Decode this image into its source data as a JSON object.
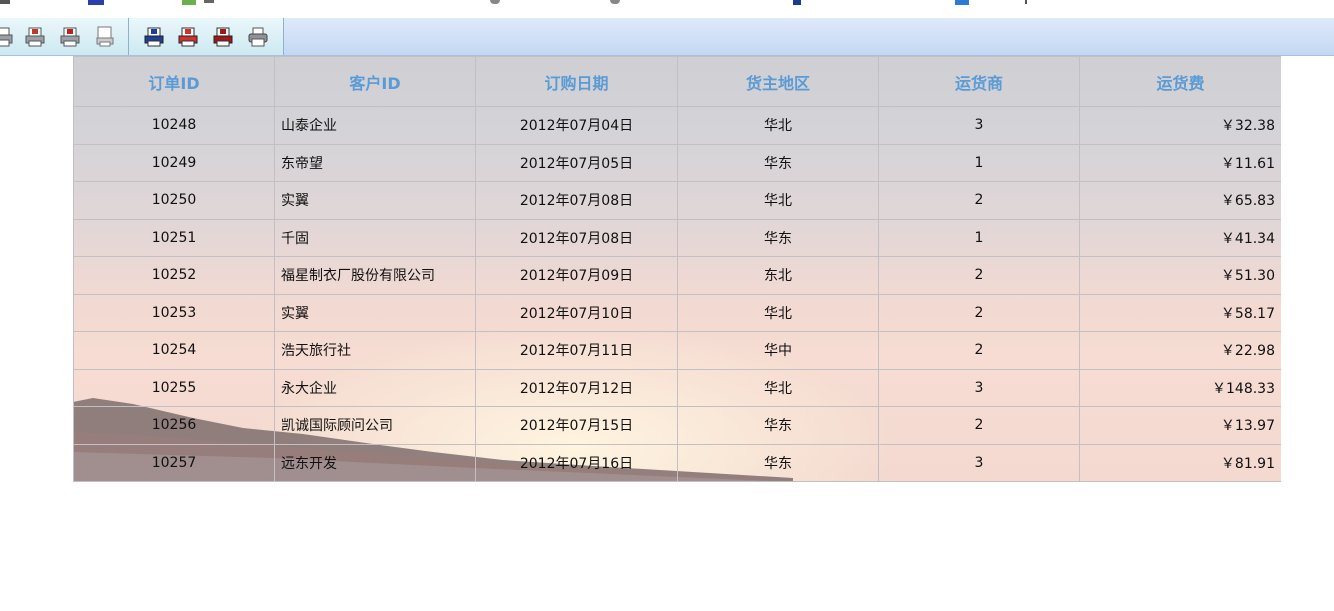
{
  "toolbar": {
    "group1": [
      "print-icon",
      "export-pdf-icon",
      "export-pdf-icon",
      "print-preview-icon"
    ],
    "group2": [
      "export-excel-icon",
      "export-word-icon",
      "export-pdf-icon",
      "printer-icon"
    ]
  },
  "table": {
    "headers": [
      "订单ID",
      "客户ID",
      "订购日期",
      "货主地区",
      "运货商",
      "运货费"
    ],
    "rows": [
      [
        "10248",
        "山泰企业",
        "2012年07月04日",
        "华北",
        "3",
        "￥32.38"
      ],
      [
        "10249",
        "东帝望",
        "2012年07月05日",
        "华东",
        "1",
        "￥11.61"
      ],
      [
        "10250",
        "实翼",
        "2012年07月08日",
        "华北",
        "2",
        "￥65.83"
      ],
      [
        "10251",
        "千固",
        "2012年07月08日",
        "华东",
        "1",
        "￥41.34"
      ],
      [
        "10252",
        "福星制衣厂股份有限公司",
        "2012年07月09日",
        "东北",
        "2",
        "￥51.30"
      ],
      [
        "10253",
        "实翼",
        "2012年07月10日",
        "华北",
        "2",
        "￥58.17"
      ],
      [
        "10254",
        "浩天旅行社",
        "2012年07月11日",
        "华中",
        "2",
        "￥22.98"
      ],
      [
        "10255",
        "永大企业",
        "2012年07月12日",
        "华北",
        "3",
        "￥148.33"
      ],
      [
        "10256",
        "凯诚国际顾问公司",
        "2012年07月15日",
        "华东",
        "2",
        "￥13.97"
      ],
      [
        "10257",
        "远东开发",
        "2012年07月16日",
        "华东",
        "3",
        "￥81.91"
      ]
    ]
  },
  "colors": {
    "header_text": "#5b9bd5",
    "grid_line": "#c3bfc3",
    "toolbar_bg": "#cfe0f6"
  }
}
